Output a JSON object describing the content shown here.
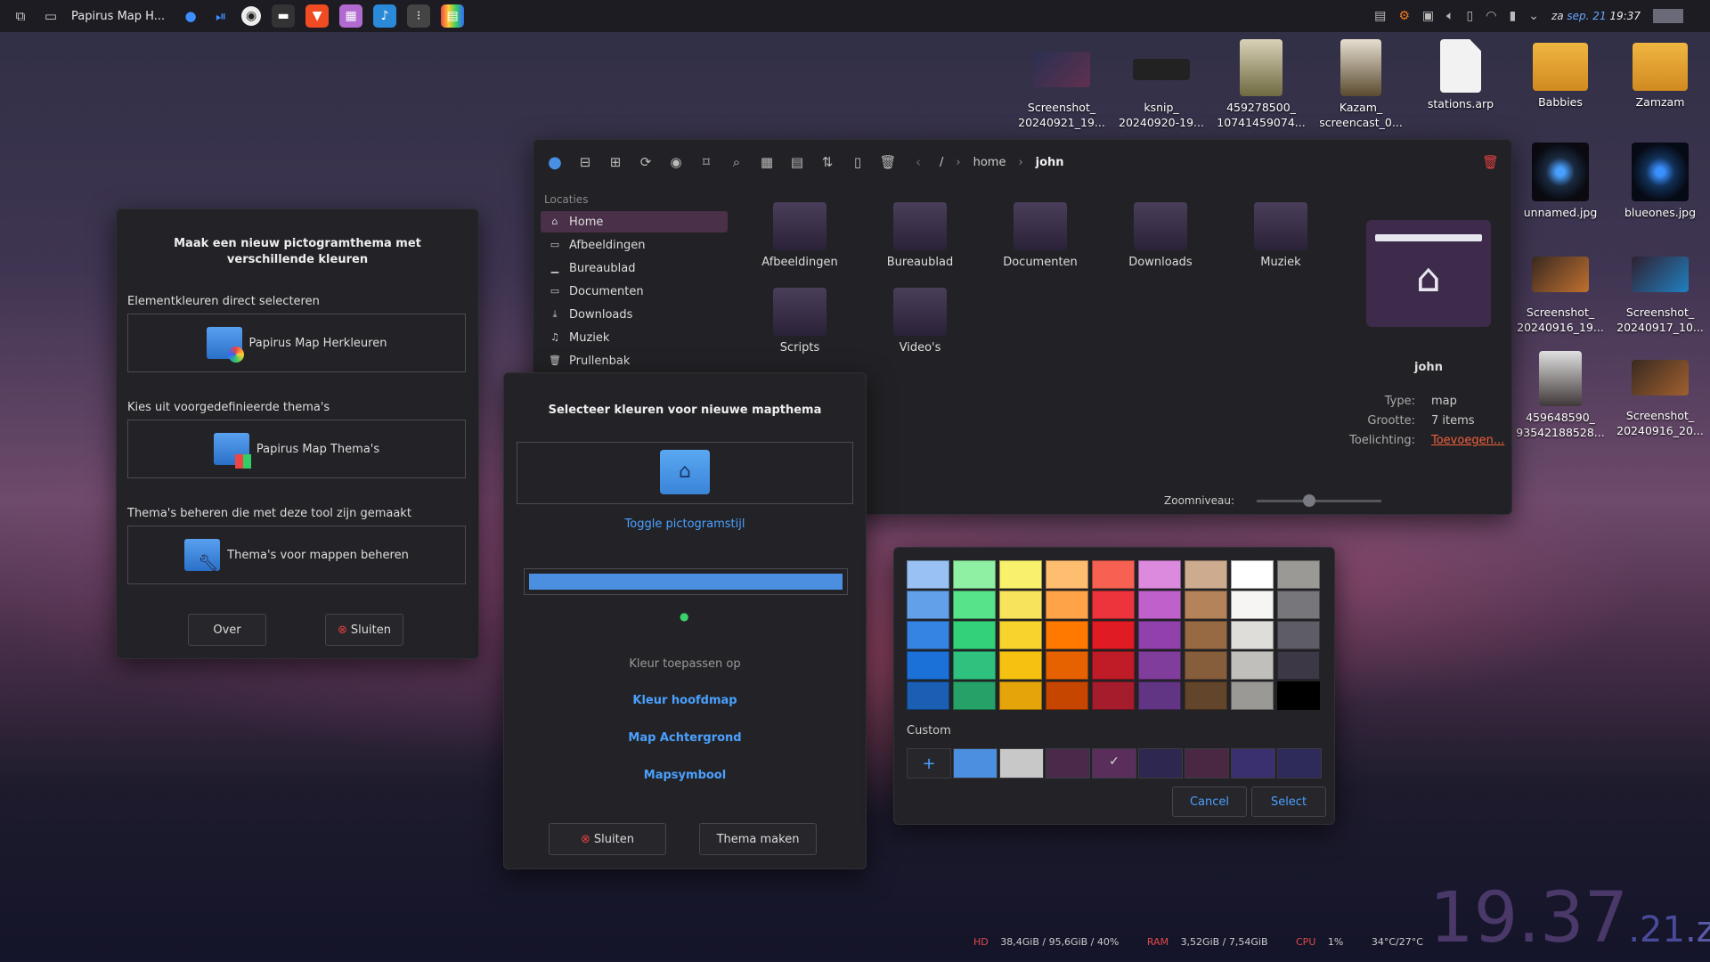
{
  "taskbar": {
    "window_title": "Papirus Map H...",
    "clock_day": "za",
    "clock_date": "sep. 21",
    "clock_time": "19:37"
  },
  "desktop_icons": [
    {
      "label": "Screenshot_\n20240921_19..."
    },
    {
      "label": "ksnip_\n20240920-19..."
    },
    {
      "label": "459278500_\n10741459074..."
    },
    {
      "label": "Kazam_\nscreencast_0..."
    },
    {
      "label": "stations.arp"
    },
    {
      "label": "Babbies"
    },
    {
      "label": "Zamzam"
    },
    {
      "label": "unnamed.jpg"
    },
    {
      "label": "blueones.jpg"
    },
    {
      "label": "Screenshot_\n20240916_19..."
    },
    {
      "label": "Screenshot_\n20240917_10..."
    },
    {
      "label": "459648590_\n93542188528..."
    },
    {
      "label": "Screenshot_\n20240916_20..."
    }
  ],
  "left_dialog": {
    "title": "Maak een nieuw pictogramthema met verschillende kleuren",
    "section1": "Elementkleuren direct selecteren",
    "button1": "Papirus Map Herkleuren",
    "section2": "Kies uit voorgedefinieerde thema's",
    "button2": "Papirus Map Thema's",
    "section3": "Thema's beheren die met deze tool zijn gemaakt",
    "button3": "Thema's voor mappen beheren",
    "about": "Over",
    "close": "Sluiten"
  },
  "file_manager": {
    "breadcrumb_root": "/",
    "breadcrumb_home": "home",
    "breadcrumb_current": "john",
    "sidebar_header": "Locaties",
    "sidebar": [
      "Home",
      "Afbeeldingen",
      "Bureaublad",
      "Documenten",
      "Downloads",
      "Muziek",
      "Prullenbak"
    ],
    "items": [
      "Afbeeldingen",
      "Bureaublad",
      "Documenten",
      "Downloads",
      "Muziek",
      "Scripts",
      "Video's"
    ],
    "info_name": "john",
    "info_type_label": "Type:",
    "info_type": "map",
    "info_size_label": "Grootte:",
    "info_size": "7 items",
    "info_comment_label": "Toelichting:",
    "info_comment": "Toevoegen...",
    "zoom_label": "Zoomniveau:",
    "zoom_level": 0.42
  },
  "color_dialog": {
    "title": "Selecteer kleuren voor nieuwe mapthema",
    "toggle": "Toggle pictogramstijl",
    "apply_label": "Kleur toepassen op",
    "opt1": "Kleur hoofdmap",
    "opt2": "Map Achtergrond",
    "opt3": "Mapsymbool",
    "close": "Sluiten",
    "make": "Thema maken",
    "selected_color": "#4a8fe0"
  },
  "color_picker": {
    "custom_label": "Custom",
    "add_glyph": "+",
    "cancel": "Cancel",
    "select": "Select",
    "palette": [
      [
        "#99c1f1",
        "#8ff0a4",
        "#f9f06b",
        "#ffbe6f",
        "#f66151",
        "#dc8add",
        "#cdab8f",
        "#ffffff",
        "#9a9996"
      ],
      [
        "#62a0ea",
        "#57e389",
        "#f8e45c",
        "#ffa348",
        "#ed333b",
        "#c061cb",
        "#b5835a",
        "#f6f5f4",
        "#77767b"
      ],
      [
        "#3584e4",
        "#33d17a",
        "#f6d32d",
        "#ff7800",
        "#e01b24",
        "#9141ac",
        "#986a44",
        "#deddda",
        "#5e5c64"
      ],
      [
        "#1c71d8",
        "#2ec27e",
        "#f5c211",
        "#e66100",
        "#c01c28",
        "#813d9c",
        "#865e3c",
        "#c0bfbc",
        "#3d3846"
      ],
      [
        "#1a5fb4",
        "#26a269",
        "#e5a50a",
        "#c64600",
        "#a51d2d",
        "#613583",
        "#63452c",
        "#9a9996",
        "#000000"
      ]
    ],
    "custom_colors": [
      "#4a8fe0",
      "#c8c8c8",
      "#4a2a4a",
      "#5a2e5a",
      "#2e2850",
      "#4a2844",
      "#3a3070",
      "#2e2a5a"
    ]
  },
  "status": {
    "hd_label": "HD",
    "hd_value": "38,4GiB / 95,6GiB / 40%",
    "ram_label": "RAM",
    "ram_value": "3,52GiB / 7,54GiB",
    "cpu_label": "CPU",
    "cpu_value": "1%",
    "temps": "34°C/27°C",
    "big_clock_main": "19.37",
    "big_clock_sec": ".21",
    "big_clock_day": ".za"
  }
}
